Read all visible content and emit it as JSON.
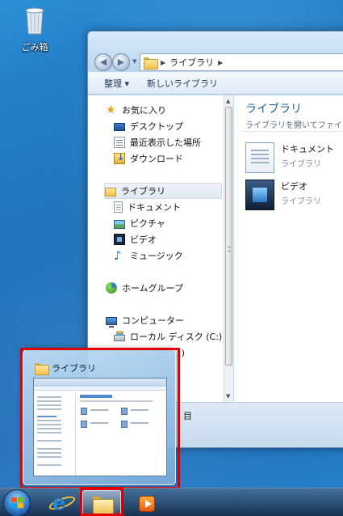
{
  "desktop": {
    "recycle_bin_label": "ごみ箱"
  },
  "window": {
    "address": {
      "segments": [
        "ライブラリ"
      ]
    },
    "toolbar": {
      "organize_label": "整理 ▾",
      "new_library_label": "新しいライブラリ"
    },
    "nav": {
      "favorites": "お気に入り",
      "desktop": "デスクトップ",
      "recent": "最近表示した場所",
      "downloads": "ダウンロード",
      "libraries": "ライブラリ",
      "documents": "ドキュメント",
      "pictures": "ピクチャ",
      "videos": "ビデオ",
      "music": "ミュージック",
      "homegroup": "ホームグループ",
      "computer": "コンピューター",
      "local_disk": "ローカル ディスク (C:)",
      "local_disk_clipped": ":)"
    },
    "content": {
      "title": "ライブラリ",
      "subtitle": "ライブラリを開いてファイ",
      "items": [
        {
          "name": "ドキュメント",
          "kind": "ライブラリ"
        },
        {
          "name": "ビデオ",
          "kind": "ライブラリ"
        }
      ]
    },
    "bottom_glyph": "目"
  },
  "thumbnail": {
    "title": "ライブラリ"
  },
  "colors": {
    "highlight_frame": "#e00000",
    "accent": "#1e5fa0"
  },
  "taskbar": {
    "start_icon": "windows-flag-icon",
    "pinned": [
      "internet-explorer-icon",
      "windows-explorer-icon",
      "media-player-icon"
    ]
  }
}
